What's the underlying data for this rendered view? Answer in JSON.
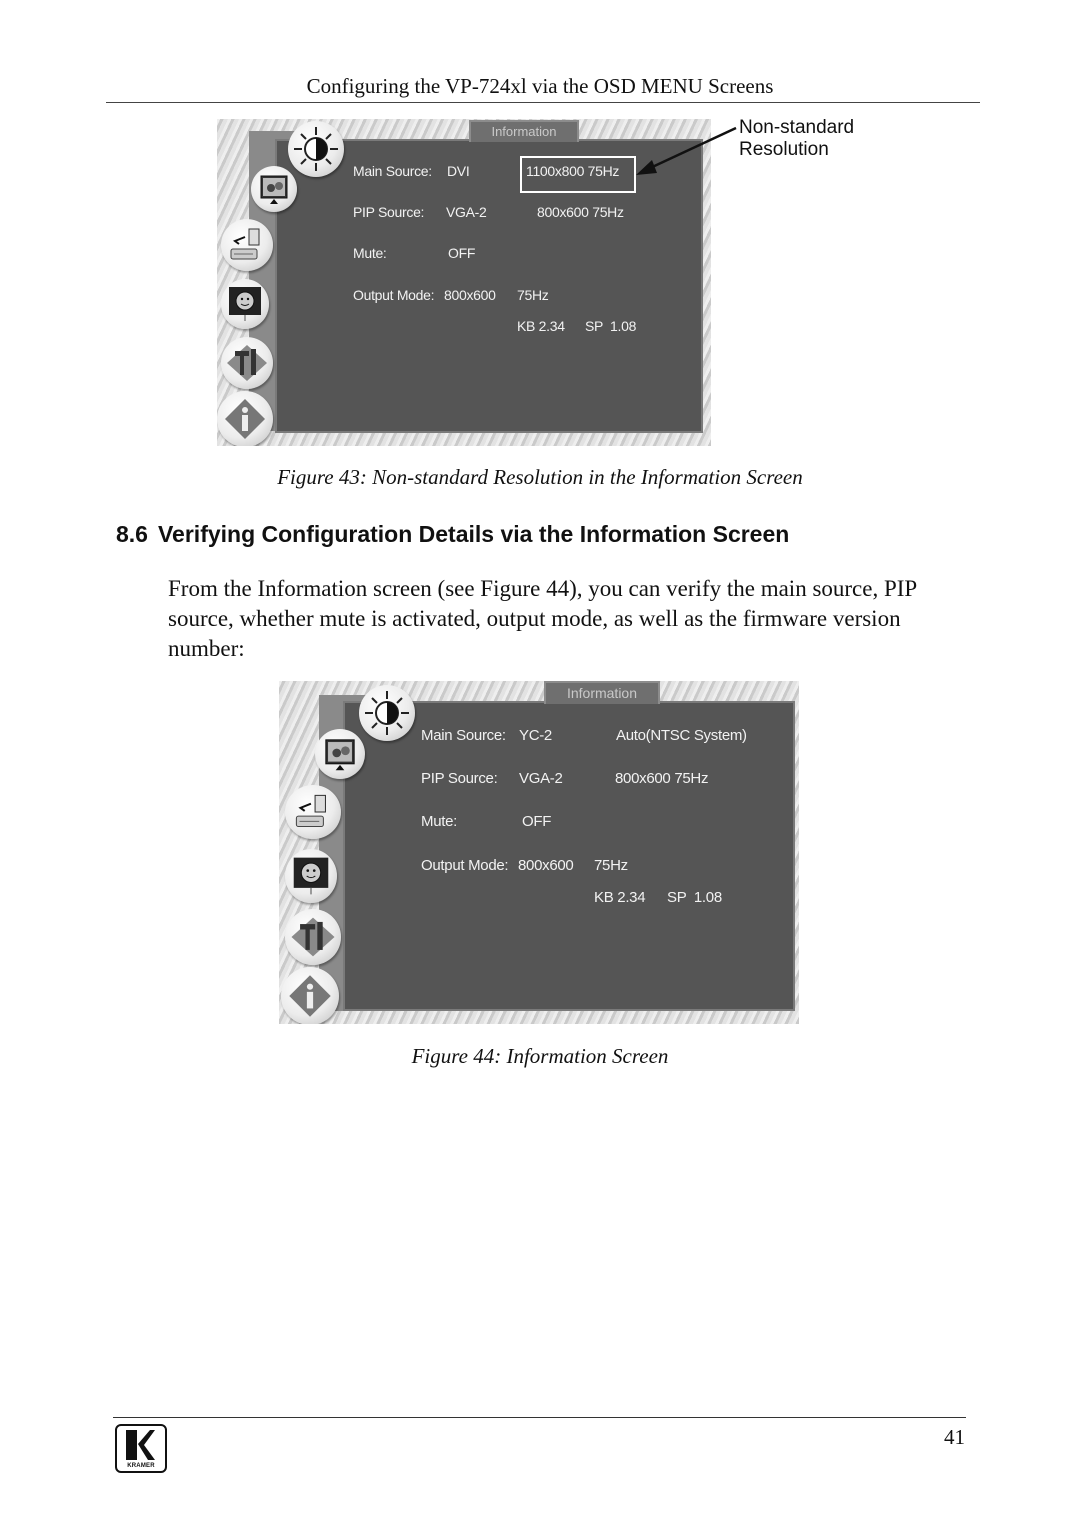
{
  "header": {
    "running_title": "Configuring the VP-724xl via the OSD MENU Screens"
  },
  "figure43": {
    "osd": {
      "tab_label": "Information",
      "rows": [
        {
          "label": "Main Source:",
          "value": "DVI",
          "extra": "1100x800 75Hz"
        },
        {
          "label": "PIP Source:",
          "value": "VGA-2",
          "extra": "800x600 75Hz"
        },
        {
          "label": "Mute:",
          "value": "OFF",
          "extra": ""
        },
        {
          "label": "Output Mode:",
          "value": "800x600",
          "extra": "75Hz"
        }
      ],
      "firmware": {
        "kb": "KB 2.34",
        "sp": "SP  1.08"
      },
      "menu_icons": [
        "brightness-contrast-icon",
        "picture-icon",
        "input-source-icon",
        "geometry-icon",
        "tools-icon",
        "information-icon"
      ]
    },
    "callout": {
      "line1": "Non-standard",
      "line2": "Resolution"
    },
    "caption": "Figure 43: Non-standard Resolution in the Information Screen"
  },
  "section": {
    "number": "8.6",
    "title": "Verifying Configuration Details via the Information Screen",
    "paragraph": "From the Information screen (see Figure 44), you can verify the main source, PIP source, whether mute is activated, output mode, as well as the firmware version number:"
  },
  "figure44": {
    "osd": {
      "tab_label": "Information",
      "rows": [
        {
          "label": "Main Source:",
          "value": "YC-2",
          "extra": "Auto(NTSC System)"
        },
        {
          "label": "PIP Source:",
          "value": "VGA-2",
          "extra": "800x600 75Hz"
        },
        {
          "label": "Mute:",
          "value": "OFF",
          "extra": ""
        },
        {
          "label": "Output Mode:",
          "value": "800x600",
          "extra": "75Hz"
        }
      ],
      "firmware": {
        "kb": "KB 2.34",
        "sp": "SP  1.08"
      },
      "menu_icons": [
        "brightness-contrast-icon",
        "picture-icon",
        "input-source-icon",
        "geometry-icon",
        "tools-icon",
        "information-icon"
      ]
    },
    "caption": "Figure 44: Information Screen"
  },
  "footer": {
    "logo_text": "KRAMER",
    "page_number": "41"
  }
}
